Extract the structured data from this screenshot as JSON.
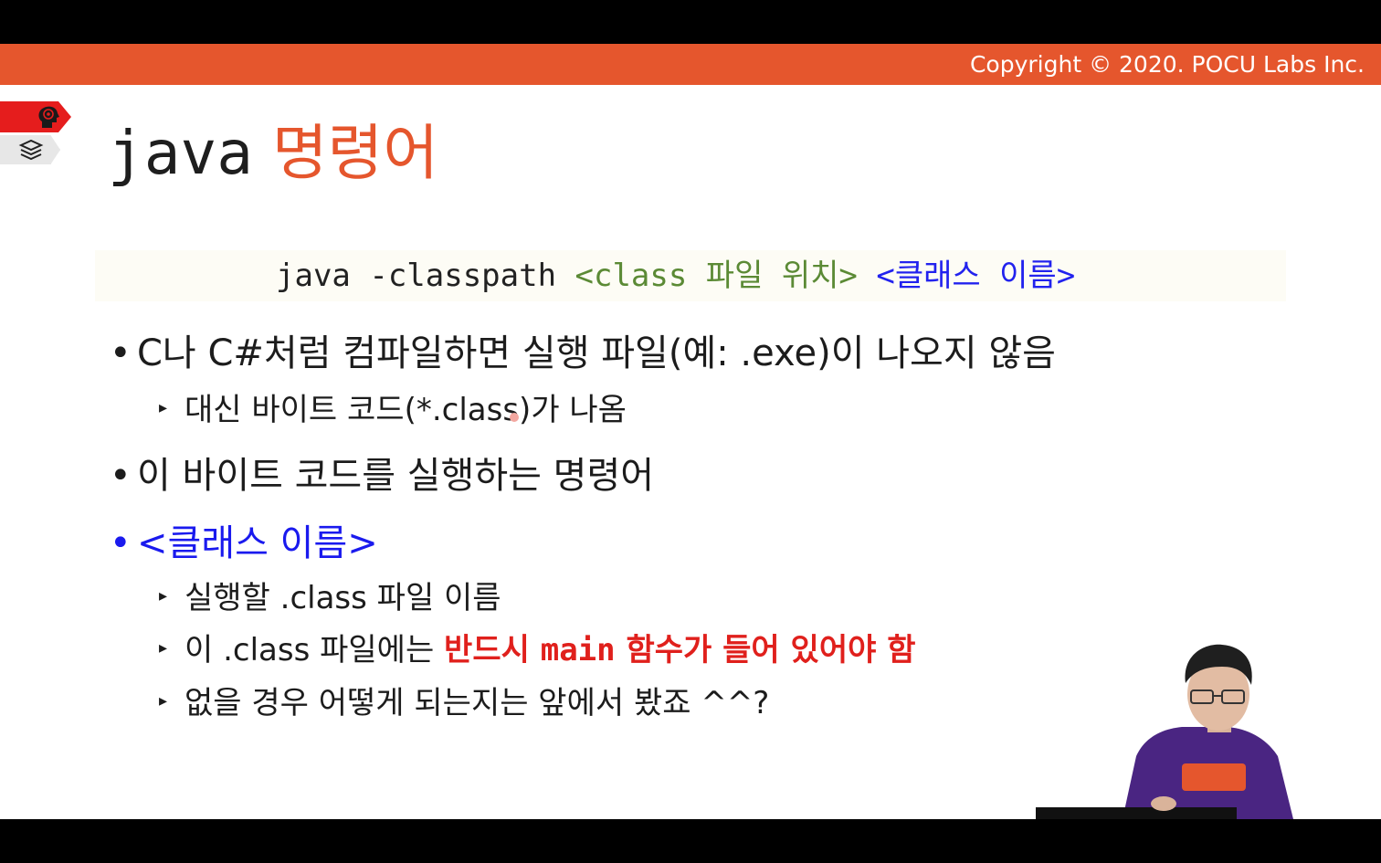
{
  "header": {
    "copyright": "Copyright © 2020. POCU Labs Inc."
  },
  "colors": {
    "accent": "#e5562d",
    "link_blue": "#1a1aee",
    "emphasis_red": "#e0201c",
    "code_green": "#5b8a35"
  },
  "icons": {
    "tab1": "brain-icon",
    "tab2": "books-icon"
  },
  "slide": {
    "title_code": "java",
    "title_korean": "명령어",
    "code": {
      "cmd": "java -classpath ",
      "arg1": "<class 파일 위치>",
      "space": " ",
      "arg2": "<클래스 이름>"
    },
    "bullets": [
      {
        "text": "C나 C#처럼 컴파일하면 실행 파일(예: .exe)이 나오지 않음"
      },
      {
        "text": "대신 바이트 코드(*.class)가 나옴"
      },
      {
        "text": "이 바이트 코드를 실행하는 명령어"
      },
      {
        "text": "<클래스 이름>"
      },
      {
        "text": "실행할 .class 파일 이름"
      },
      {
        "text_pre": "이 .class 파일에는 ",
        "text_em1": "반드시 ",
        "text_code": "main",
        "text_em2": " 함수가 들어 있어야 함"
      },
      {
        "text": "없을 경우 어떻게 되는지는 앞에서 봤죠 ^^?"
      }
    ],
    "bullet_marker": "•",
    "sub_marker": "▸"
  }
}
